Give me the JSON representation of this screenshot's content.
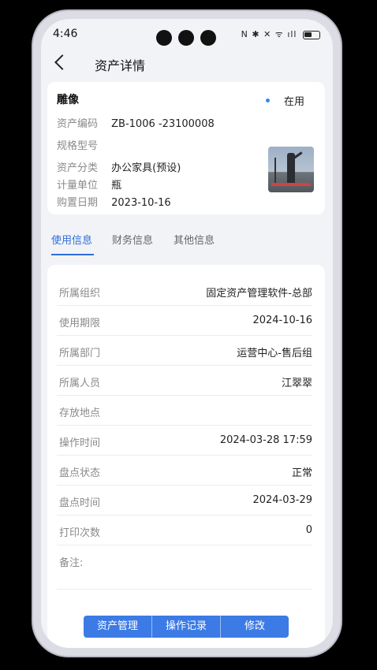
{
  "status_bar": {
    "time": "4:46",
    "icons": "N ✱ ✕ ᯤ ıll"
  },
  "nav": {
    "title": "资产详情"
  },
  "asset": {
    "name": "雕像",
    "state": "在用",
    "fields": [
      {
        "label": "资产编码",
        "value": "ZB-1006 -23100008"
      },
      {
        "label": "规格型号",
        "value": ""
      },
      {
        "label": "资产分类",
        "value": "办公家具(预设)"
      },
      {
        "label": "计量单位",
        "value": "瓶"
      },
      {
        "label": "购置日期",
        "value": "2023-10-16"
      }
    ]
  },
  "tabs": [
    "使用信息",
    "财务信息",
    "其他信息"
  ],
  "details": [
    {
      "label": "所属组织",
      "value": "固定资产管理软件-总部"
    },
    {
      "label": "使用期限",
      "value": "2024-10-16"
    },
    {
      "label": "所属部门",
      "value": "运营中心-售后组"
    },
    {
      "label": "所属人员",
      "value": "江翠翠"
    },
    {
      "label": "存放地点",
      "value": ""
    },
    {
      "label": "操作时间",
      "value": "2024-03-28 17:59"
    },
    {
      "label": "盘点状态",
      "value": "正常"
    },
    {
      "label": "盘点时间",
      "value": "2024-03-29"
    },
    {
      "label": "打印次数",
      "value": "0"
    },
    {
      "label": "备注:",
      "value": ""
    }
  ],
  "actions": [
    "资产管理",
    "操作记录",
    "修改"
  ],
  "colors": {
    "accent": "#2f6fd9",
    "button": "#3c7be6",
    "state_dot": "#2b8cf0"
  }
}
